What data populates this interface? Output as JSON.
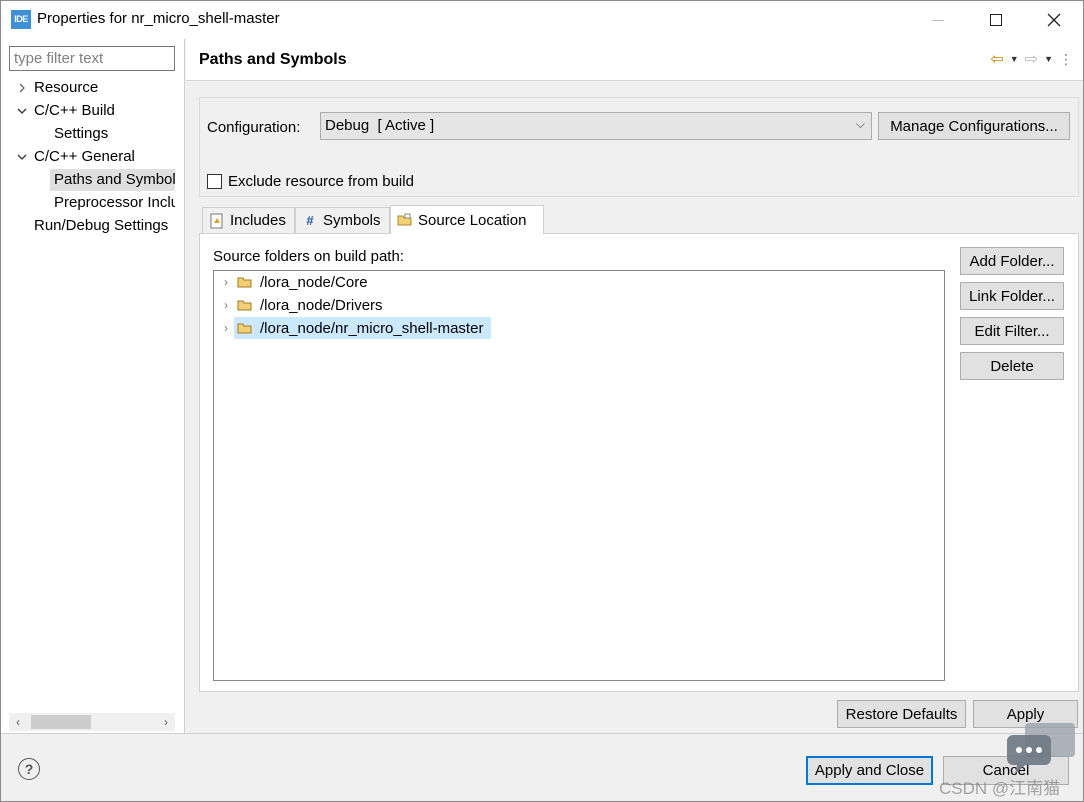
{
  "window": {
    "app_icon_text": "IDE",
    "title": "Properties for nr_micro_shell-master"
  },
  "left": {
    "filter_placeholder": "type filter text",
    "tree": [
      {
        "label": "Resource",
        "expand": "collapsed"
      },
      {
        "label": "C/C++ Build",
        "expand": "expanded"
      },
      {
        "label": "Settings",
        "expand": "none"
      },
      {
        "label": "C/C++ General",
        "expand": "expanded"
      },
      {
        "label": "Paths and Symbols",
        "expand": "none",
        "selected": true
      },
      {
        "label": "Preprocessor Include Paths, Macros etc.",
        "expand": "none"
      },
      {
        "label": "Run/Debug Settings",
        "expand": "none"
      }
    ]
  },
  "page": {
    "title": "Paths and Symbols"
  },
  "config": {
    "label": "Configuration:",
    "selected": "Debug  [ Active ]",
    "manage_button": "Manage Configurations...",
    "exclude_label": "Exclude resource from build",
    "exclude_checked": false
  },
  "tabs": [
    {
      "label": "Includes",
      "icon": "includes-icon"
    },
    {
      "label": "Symbols",
      "icon": "hash-icon"
    },
    {
      "label": "Source Location",
      "icon": "source-folder-icon",
      "active": true
    }
  ],
  "source": {
    "label": "Source folders on build path:",
    "folders": [
      {
        "path": "/lora_node/Core"
      },
      {
        "path": "/lora_node/Drivers"
      },
      {
        "path": "/lora_node/nr_micro_shell-master",
        "selected": true
      }
    ],
    "buttons": {
      "add": "Add Folder...",
      "link": "Link Folder...",
      "edit": "Edit Filter...",
      "delete": "Delete"
    }
  },
  "actions": {
    "restore": "Restore Defaults",
    "apply": "Apply",
    "apply_close": "Apply and Close",
    "cancel": "Cancel"
  },
  "watermark": "CSDN @江南猫",
  "colors": {
    "accent": "#0078d7",
    "selection": "#cce8ff",
    "tree_selection": "#e0e0e0",
    "folder": "#e8b84a"
  }
}
